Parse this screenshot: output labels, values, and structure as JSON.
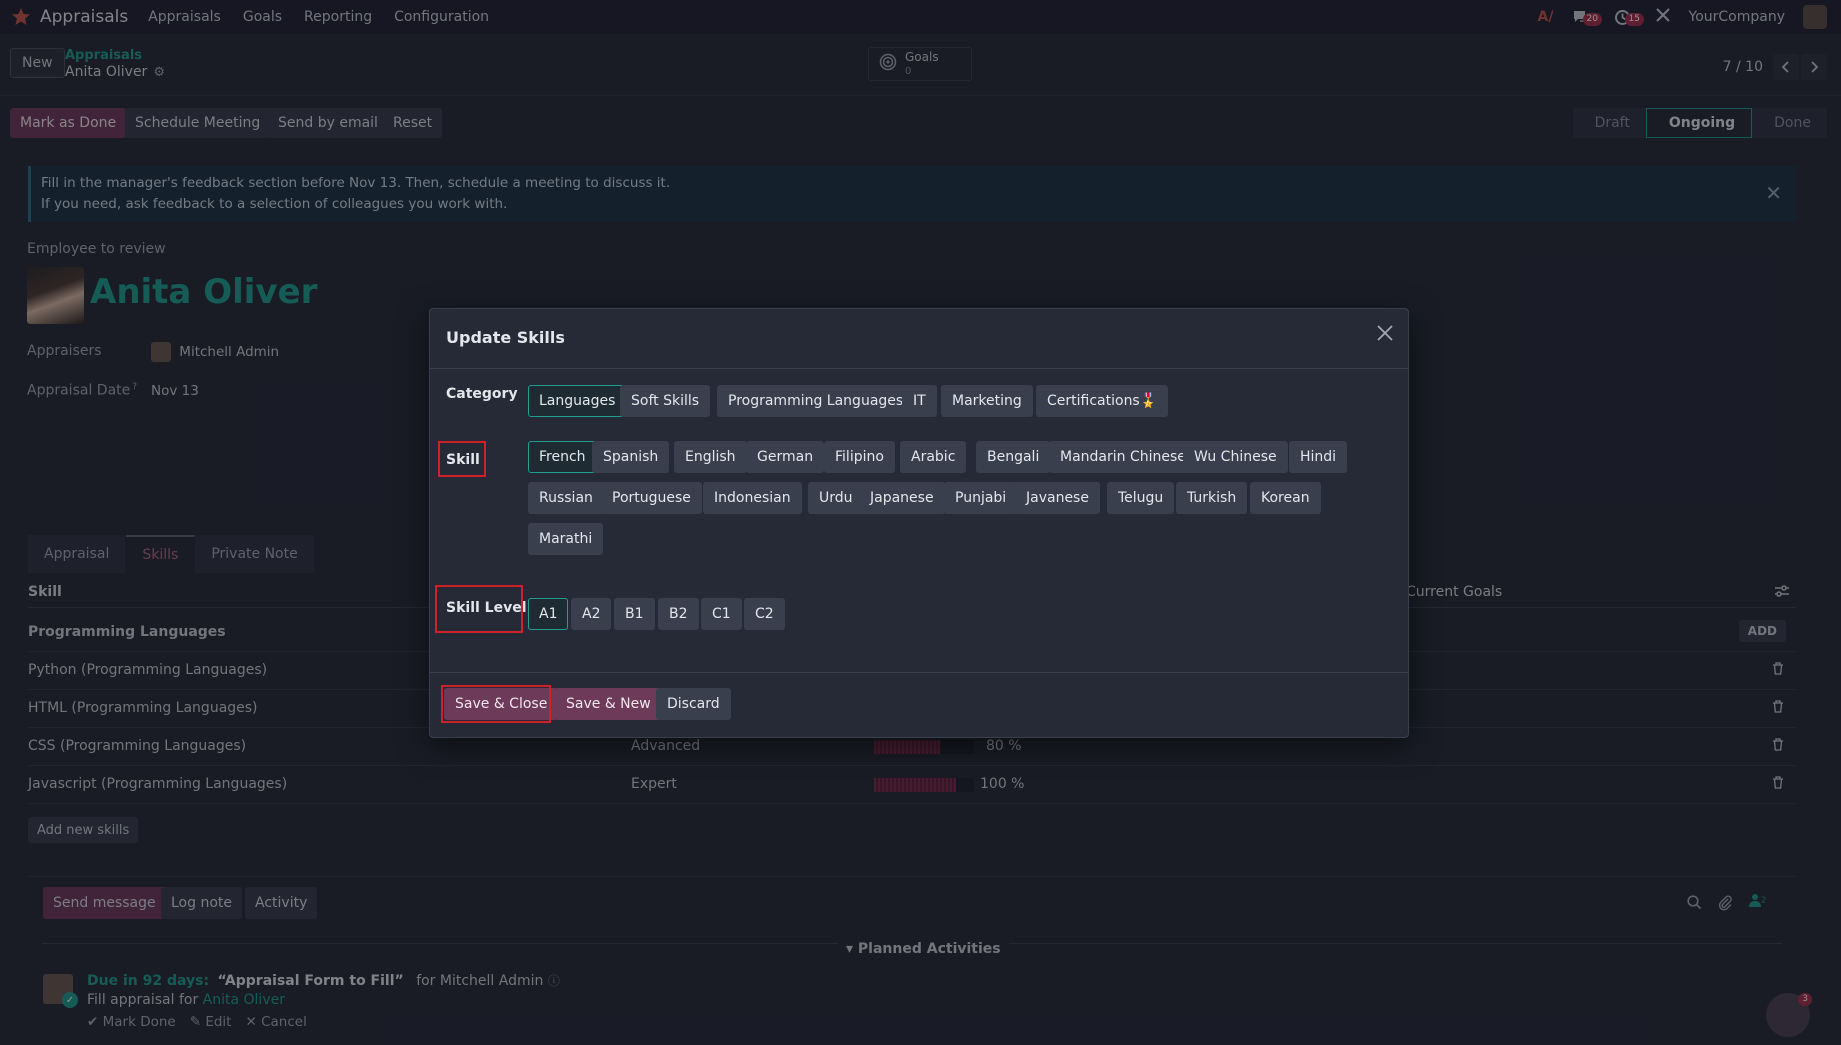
{
  "topnav": {
    "app_title": "Appraisals",
    "menu": [
      "Appraisals",
      "Goals",
      "Reporting",
      "Configuration"
    ],
    "messages_count": "20",
    "activities_count": "15",
    "company": "YourCompany"
  },
  "control": {
    "new_label": "New",
    "breadcrumb_parent": "Appraisals",
    "breadcrumb_current": "Anita Oliver",
    "goals_label": "Goals",
    "goals_count": "0",
    "pager": "7 / 10"
  },
  "actions": {
    "mark_done": "Mark as Done",
    "schedule": "Schedule Meeting",
    "send_email": "Send by email",
    "reset": "Reset",
    "stages": [
      "Draft",
      "Ongoing",
      "Done"
    ]
  },
  "alert": {
    "line1": "Fill in the manager's feedback section before Nov 13. Then, schedule a meeting to discuss it.",
    "line2": "If you need, ask feedback to a selection of colleagues you work with."
  },
  "form": {
    "employee_label": "Employee to review",
    "employee_name": "Anita Oliver",
    "appraisers_label": "Appraisers",
    "appraiser": "Mitchell Admin",
    "date_label": "Appraisal Date",
    "date_help": "?",
    "date_value": "Nov 13"
  },
  "tabs": [
    "Appraisal",
    "Skills",
    "Private Note"
  ],
  "skills_table": {
    "col_skill": "Skill",
    "col_goals": "Current Goals",
    "group": "Programming Languages",
    "add": "ADD",
    "rows": [
      {
        "skill": "Python (Programming Languages)",
        "level": "",
        "progress_label": "",
        "progress": null
      },
      {
        "skill": "HTML (Programming Languages)",
        "level": "",
        "progress_label": "",
        "progress": null
      },
      {
        "skill": "CSS (Programming Languages)",
        "level": "Advanced",
        "progress_label": "80 %",
        "progress": 80
      },
      {
        "skill": "Javascript (Programming Languages)",
        "level": "Expert",
        "progress_label": "100 %",
        "progress": 100
      }
    ],
    "add_new": "Add new skills"
  },
  "chatter": {
    "send_message": "Send message",
    "log_note": "Log note",
    "activity": "Activity",
    "followers": "2",
    "planned": "Planned Activities",
    "due": "Due in 92 days:",
    "activity_title": "“Appraisal Form to Fill”",
    "for_user": "for Mitchell Admin",
    "summary_prefix": "Fill appraisal for",
    "summary_link": "Anita Oliver",
    "mark_done": "Mark Done",
    "edit": "Edit",
    "cancel": "Cancel",
    "bot_badge": "3"
  },
  "modal": {
    "title": "Update Skills",
    "category_label": "Category",
    "categories": [
      "Languages",
      "Soft Skills",
      "Programming Languages",
      "IT",
      "Marketing",
      "Certifications🎖️"
    ],
    "selected_category": "Languages",
    "skill_label": "Skill",
    "skills": [
      "French",
      "Spanish",
      "English",
      "German",
      "Filipino",
      "Arabic",
      "Bengali",
      "Mandarin Chinese",
      "Wu Chinese",
      "Hindi",
      "Russian",
      "Portuguese",
      "Indonesian",
      "Urdu",
      "Japanese",
      "Punjabi",
      "Javanese",
      "Telugu",
      "Turkish",
      "Korean",
      "Marathi"
    ],
    "selected_skill": "French",
    "level_label": "Skill Level",
    "levels": [
      "A1",
      "A2",
      "B1",
      "B2",
      "C1",
      "C2"
    ],
    "selected_level": "A1",
    "save_close": "Save & Close",
    "save_new": "Save & New",
    "discard": "Discard"
  }
}
